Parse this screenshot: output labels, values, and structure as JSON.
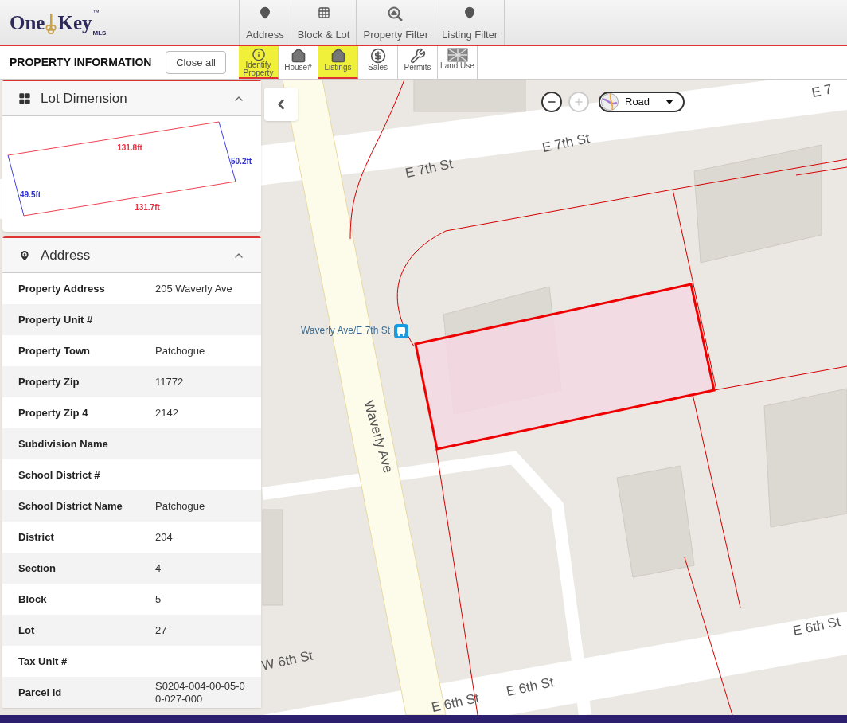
{
  "header": {
    "brand": [
      "One",
      "Key"
    ],
    "brand_sub": "MLS",
    "brand_mark": "™"
  },
  "search_tabs": [
    {
      "label": "Address",
      "kind": "pin"
    },
    {
      "label": "Block & Lot",
      "kind": "grid"
    },
    {
      "label": "Property Filter",
      "kind": "home-search"
    },
    {
      "label": "Listing Filter",
      "kind": "pin"
    }
  ],
  "panel_title": "PROPERTY INFORMATION",
  "close_button": "Close all",
  "tools": [
    {
      "label": "Identify Property",
      "kind": "identify",
      "selected": true
    },
    {
      "label": "House#",
      "kind": "house-list",
      "selected": false
    },
    {
      "label": "Listings",
      "kind": "house-dollar",
      "selected": true
    },
    {
      "label": "Sales",
      "kind": "dollar",
      "selected": false
    },
    {
      "label": "Permits",
      "kind": "tools",
      "selected": false
    },
    {
      "label": "Land Use",
      "kind": "land",
      "selected": false
    }
  ],
  "lot_dimension": {
    "title": "Lot Dimension",
    "expanded": true,
    "top": "131.8ft",
    "right": "50.2ft",
    "left": "49.5ft",
    "bottom": "131.7ft"
  },
  "address": {
    "title": "Address",
    "expanded": true,
    "rows": [
      {
        "label": "Property Address",
        "value": "205 Waverly Ave"
      },
      {
        "label": "Property Unit #",
        "value": ""
      },
      {
        "label": "Property Town",
        "value": "Patchogue"
      },
      {
        "label": "Property Zip",
        "value": "11772"
      },
      {
        "label": "Property Zip 4",
        "value": "2142"
      },
      {
        "label": "Subdivision Name",
        "value": ""
      },
      {
        "label": "School District #",
        "value": ""
      },
      {
        "label": "School District Name",
        "value": "Patchogue"
      },
      {
        "label": "District",
        "value": "204"
      },
      {
        "label": "Section",
        "value": "4"
      },
      {
        "label": "Block",
        "value": "5"
      },
      {
        "label": "Lot",
        "value": "27"
      },
      {
        "label": "Tax Unit #",
        "value": ""
      },
      {
        "label": "Parcel Id",
        "value": "S0204-004-00-05-00-027-000"
      }
    ]
  },
  "map": {
    "zoom_out": {
      "disabled": false
    },
    "zoom_in": {
      "disabled": true
    },
    "layer": "Road",
    "labels": [
      {
        "text": "E 7th St",
        "kind": "street"
      },
      {
        "text": "E 7th St",
        "kind": "street"
      },
      {
        "text": "E 7",
        "kind": "street"
      },
      {
        "text": "Waverly Ave",
        "kind": "street"
      },
      {
        "text": "W 6th St",
        "kind": "street"
      },
      {
        "text": "E 6th St",
        "kind": "street"
      },
      {
        "text": "E 6th St",
        "kind": "street"
      },
      {
        "text": "E 6th St",
        "kind": "street"
      },
      {
        "text": "Waverly Ave/E 7th St",
        "kind": "transit"
      }
    ]
  }
}
